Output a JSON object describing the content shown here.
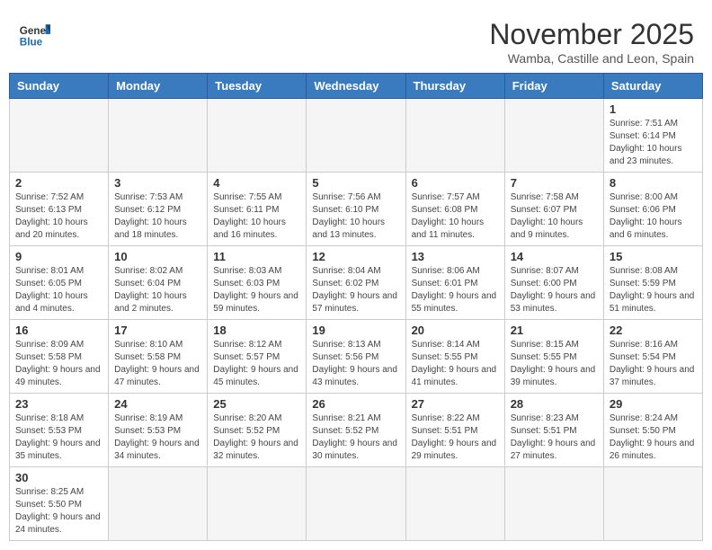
{
  "header": {
    "logo_general": "General",
    "logo_blue": "Blue",
    "month_title": "November 2025",
    "subtitle": "Wamba, Castille and Leon, Spain"
  },
  "weekdays": [
    "Sunday",
    "Monday",
    "Tuesday",
    "Wednesday",
    "Thursday",
    "Friday",
    "Saturday"
  ],
  "weeks": [
    [
      {
        "day": "",
        "info": ""
      },
      {
        "day": "",
        "info": ""
      },
      {
        "day": "",
        "info": ""
      },
      {
        "day": "",
        "info": ""
      },
      {
        "day": "",
        "info": ""
      },
      {
        "day": "",
        "info": ""
      },
      {
        "day": "1",
        "info": "Sunrise: 7:51 AM\nSunset: 6:14 PM\nDaylight: 10 hours and 23 minutes."
      }
    ],
    [
      {
        "day": "2",
        "info": "Sunrise: 7:52 AM\nSunset: 6:13 PM\nDaylight: 10 hours and 20 minutes."
      },
      {
        "day": "3",
        "info": "Sunrise: 7:53 AM\nSunset: 6:12 PM\nDaylight: 10 hours and 18 minutes."
      },
      {
        "day": "4",
        "info": "Sunrise: 7:55 AM\nSunset: 6:11 PM\nDaylight: 10 hours and 16 minutes."
      },
      {
        "day": "5",
        "info": "Sunrise: 7:56 AM\nSunset: 6:10 PM\nDaylight: 10 hours and 13 minutes."
      },
      {
        "day": "6",
        "info": "Sunrise: 7:57 AM\nSunset: 6:08 PM\nDaylight: 10 hours and 11 minutes."
      },
      {
        "day": "7",
        "info": "Sunrise: 7:58 AM\nSunset: 6:07 PM\nDaylight: 10 hours and 9 minutes."
      },
      {
        "day": "8",
        "info": "Sunrise: 8:00 AM\nSunset: 6:06 PM\nDaylight: 10 hours and 6 minutes."
      }
    ],
    [
      {
        "day": "9",
        "info": "Sunrise: 8:01 AM\nSunset: 6:05 PM\nDaylight: 10 hours and 4 minutes."
      },
      {
        "day": "10",
        "info": "Sunrise: 8:02 AM\nSunset: 6:04 PM\nDaylight: 10 hours and 2 minutes."
      },
      {
        "day": "11",
        "info": "Sunrise: 8:03 AM\nSunset: 6:03 PM\nDaylight: 9 hours and 59 minutes."
      },
      {
        "day": "12",
        "info": "Sunrise: 8:04 AM\nSunset: 6:02 PM\nDaylight: 9 hours and 57 minutes."
      },
      {
        "day": "13",
        "info": "Sunrise: 8:06 AM\nSunset: 6:01 PM\nDaylight: 9 hours and 55 minutes."
      },
      {
        "day": "14",
        "info": "Sunrise: 8:07 AM\nSunset: 6:00 PM\nDaylight: 9 hours and 53 minutes."
      },
      {
        "day": "15",
        "info": "Sunrise: 8:08 AM\nSunset: 5:59 PM\nDaylight: 9 hours and 51 minutes."
      }
    ],
    [
      {
        "day": "16",
        "info": "Sunrise: 8:09 AM\nSunset: 5:58 PM\nDaylight: 9 hours and 49 minutes."
      },
      {
        "day": "17",
        "info": "Sunrise: 8:10 AM\nSunset: 5:58 PM\nDaylight: 9 hours and 47 minutes."
      },
      {
        "day": "18",
        "info": "Sunrise: 8:12 AM\nSunset: 5:57 PM\nDaylight: 9 hours and 45 minutes."
      },
      {
        "day": "19",
        "info": "Sunrise: 8:13 AM\nSunset: 5:56 PM\nDaylight: 9 hours and 43 minutes."
      },
      {
        "day": "20",
        "info": "Sunrise: 8:14 AM\nSunset: 5:55 PM\nDaylight: 9 hours and 41 minutes."
      },
      {
        "day": "21",
        "info": "Sunrise: 8:15 AM\nSunset: 5:55 PM\nDaylight: 9 hours and 39 minutes."
      },
      {
        "day": "22",
        "info": "Sunrise: 8:16 AM\nSunset: 5:54 PM\nDaylight: 9 hours and 37 minutes."
      }
    ],
    [
      {
        "day": "23",
        "info": "Sunrise: 8:18 AM\nSunset: 5:53 PM\nDaylight: 9 hours and 35 minutes."
      },
      {
        "day": "24",
        "info": "Sunrise: 8:19 AM\nSunset: 5:53 PM\nDaylight: 9 hours and 34 minutes."
      },
      {
        "day": "25",
        "info": "Sunrise: 8:20 AM\nSunset: 5:52 PM\nDaylight: 9 hours and 32 minutes."
      },
      {
        "day": "26",
        "info": "Sunrise: 8:21 AM\nSunset: 5:52 PM\nDaylight: 9 hours and 30 minutes."
      },
      {
        "day": "27",
        "info": "Sunrise: 8:22 AM\nSunset: 5:51 PM\nDaylight: 9 hours and 29 minutes."
      },
      {
        "day": "28",
        "info": "Sunrise: 8:23 AM\nSunset: 5:51 PM\nDaylight: 9 hours and 27 minutes."
      },
      {
        "day": "29",
        "info": "Sunrise: 8:24 AM\nSunset: 5:50 PM\nDaylight: 9 hours and 26 minutes."
      }
    ],
    [
      {
        "day": "30",
        "info": "Sunrise: 8:25 AM\nSunset: 5:50 PM\nDaylight: 9 hours and 24 minutes."
      },
      {
        "day": "",
        "info": ""
      },
      {
        "day": "",
        "info": ""
      },
      {
        "day": "",
        "info": ""
      },
      {
        "day": "",
        "info": ""
      },
      {
        "day": "",
        "info": ""
      },
      {
        "day": "",
        "info": ""
      }
    ]
  ]
}
